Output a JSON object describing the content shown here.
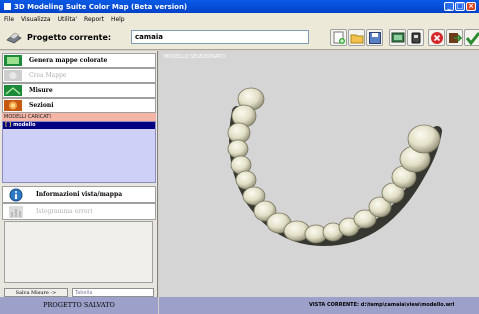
{
  "window": {
    "title": "3D Modeling Suite Color Map (Beta version)",
    "min": "_",
    "max": "□",
    "close": "×"
  },
  "menu": [
    "File",
    "Visualizza",
    "Utilita'",
    "Report",
    "Help"
  ],
  "toolbar": {
    "project_label": "Progetto corrente:",
    "project_value": "camaia",
    "buttons": [
      "add-icon",
      "open-folder-icon",
      "save-icon",
      "screenshot-icon",
      "print-icon",
      "exit-icon",
      "export-icon",
      "confirm-icon"
    ]
  },
  "sidebar": {
    "items": [
      {
        "label": "Genera mappe colorate",
        "icon": "color-map-icon",
        "enabled": true
      },
      {
        "label": "Crea Mappe",
        "icon": "map-icon",
        "enabled": false
      },
      {
        "label": "Misure",
        "icon": "measure-icon",
        "enabled": true
      },
      {
        "label": "Sezioni",
        "icon": "section-icon",
        "enabled": true
      }
    ],
    "models_header": "MODELLI CARICATI",
    "models": [
      "modello"
    ],
    "info_items": [
      {
        "label": "Informazioni vista/mappa",
        "icon": "info-icon",
        "enabled": true
      },
      {
        "label": "Istogramma errori",
        "icon": "histogram-icon",
        "enabled": false
      }
    ],
    "save_button": "Salva Misure ->",
    "save_field": "Tabella"
  },
  "viewport": {
    "label": "MODELLO SELEZIONATO"
  },
  "status": {
    "left": "PROGETTO SALVATO",
    "right": "VISTA CORRENTE: d:\\temp\\camaia\\view\\modello.wrl"
  }
}
